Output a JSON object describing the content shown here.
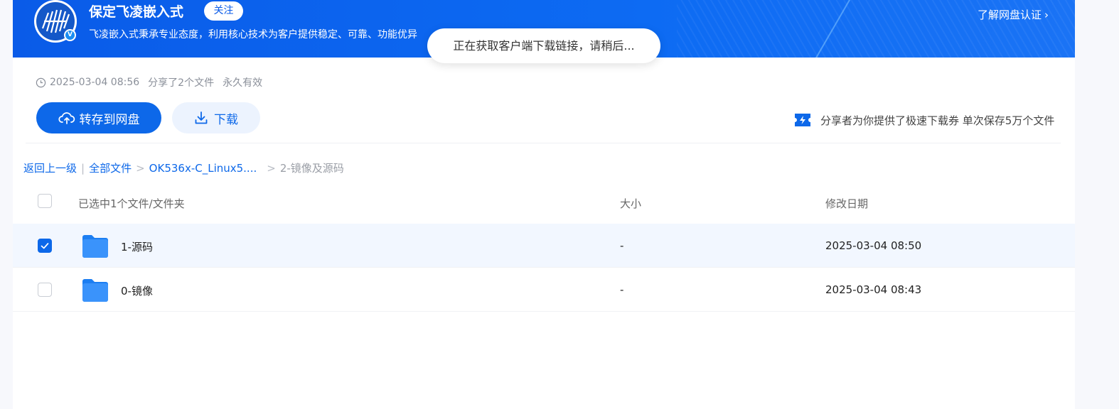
{
  "header": {
    "org_name": "保定飞凌嵌入式",
    "follow_label": "关注",
    "description": "飞凌嵌入式秉承专业态度，利用核心技术为客户提供稳定、可靠、功能优异",
    "verify_link": "了解网盘认证",
    "badge_letter": "V"
  },
  "toast": {
    "text": "正在获取客户端下载链接，请稍后..."
  },
  "share_meta": {
    "date": "2025-03-04 08:56",
    "count_text": "分享了2个文件",
    "validity": "永久有效"
  },
  "actions": {
    "save_label": "转存到网盘",
    "download_label": "下载"
  },
  "promo": {
    "text": "分享者为你提供了极速下载券 单次保存5万个文件"
  },
  "breadcrumb": {
    "back": "返回上一级",
    "divider": "|",
    "root": "全部文件",
    "level1": "OK536x-C_Linux5....",
    "current": "2-镜像及源码",
    "sep": ">"
  },
  "table": {
    "selection_text": "已选中1个文件/文件夹",
    "col_size": "大小",
    "col_date": "修改日期",
    "rows": [
      {
        "name": "1-源码",
        "size": "-",
        "date": "2025-03-04 08:50",
        "selected": true
      },
      {
        "name": "0-镜像",
        "size": "-",
        "date": "2025-03-04 08:43",
        "selected": false
      }
    ]
  },
  "colors": {
    "brand_blue": "#0d68e9",
    "banner_blue": "#0a5be8",
    "selected_row": "#f2f7ff"
  }
}
